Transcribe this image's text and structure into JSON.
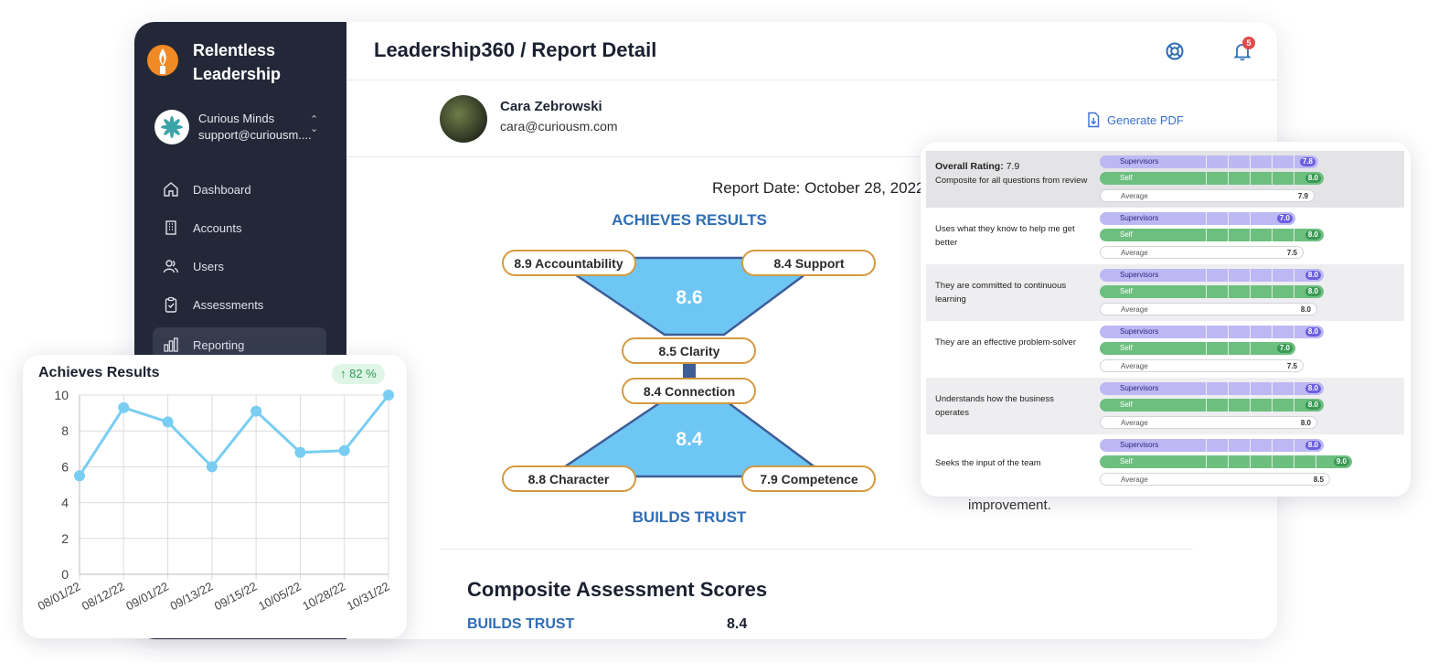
{
  "sidebar": {
    "brand_line1": "Relentless",
    "brand_line2": "Leadership",
    "org_name": "Curious Minds",
    "org_email": "support@curiousm....",
    "items": [
      {
        "label": "Dashboard",
        "icon": "home-icon"
      },
      {
        "label": "Accounts",
        "icon": "building-icon"
      },
      {
        "label": "Users",
        "icon": "users-icon"
      },
      {
        "label": "Assessments",
        "icon": "clipboard-icon"
      },
      {
        "label": "Reporting",
        "icon": "bar-chart-icon"
      }
    ]
  },
  "header": {
    "title": "Leadership360 / Report Detail",
    "notification_count": "5"
  },
  "profile": {
    "name": "Cara Zebrowski",
    "email": "cara@curiousm.com",
    "generate_label": "Generate PDF"
  },
  "report": {
    "date": "Report Date: October 28, 2022",
    "top_heading": "ACHIEVES RESULTS",
    "bottom_heading": "BUILDS TRUST",
    "top_score": "8.6",
    "bottom_score": "8.4",
    "accountability": "8.9 Accountability",
    "support": "8.4 Support",
    "clarity": "8.5 Clarity",
    "connection": "8.4 Connection",
    "character": "8.8 Character",
    "competence": "7.9 Competence",
    "improvement_text": "improvement.",
    "composite_title": "Composite Assessment Scores",
    "builds_trust_label": "BUILDS TRUST",
    "builds_trust_value": "8.4",
    "colors": {
      "heading": "#2f6db5",
      "pill_border": "#d49a3e",
      "fill": "#6ec6f5"
    }
  },
  "trend": {
    "title": "Achieves Results",
    "badge": "↑ 82 %"
  },
  "chart_data": {
    "type": "line",
    "x": [
      "08/01/22",
      "08/12/22",
      "09/01/22",
      "09/13/22",
      "09/15/22",
      "10/05/22",
      "10/28/22",
      "10/31/22"
    ],
    "series": [
      {
        "values": [
          5.5,
          9.3,
          8.5,
          6.0,
          9.1,
          6.8,
          6.9,
          10.0
        ]
      }
    ],
    "ylim": [
      0,
      10
    ],
    "yticks": [
      0,
      2,
      4,
      6,
      8,
      10
    ],
    "grid": true,
    "color": "#79cdf2"
  },
  "ratings": {
    "labels": {
      "supervisors": "Supervisors",
      "self": "Self",
      "average": "Average"
    },
    "rows": [
      {
        "title": "Overall Rating:",
        "title_value": "7.9",
        "text": "Composite for all questions from review",
        "supervisors": "7.8",
        "self": "8.0",
        "average": "7.9"
      },
      {
        "text": "Uses what they know to help me get better",
        "supervisors": "7.0",
        "self": "8.0",
        "average": "7.5"
      },
      {
        "text": "They are committed to continuous learning",
        "supervisors": "8.0",
        "self": "8.0",
        "average": "8.0"
      },
      {
        "text": "They are an effective problem-solver",
        "supervisors": "8.0",
        "self": "7.0",
        "average": "7.5"
      },
      {
        "text": "Understands how the business operates",
        "supervisors": "8.0",
        "self": "8.0",
        "average": "8.0"
      },
      {
        "text": "Seeks the input of the team",
        "supervisors": "8.0",
        "self": "9.0",
        "average": "8.5"
      }
    ]
  }
}
